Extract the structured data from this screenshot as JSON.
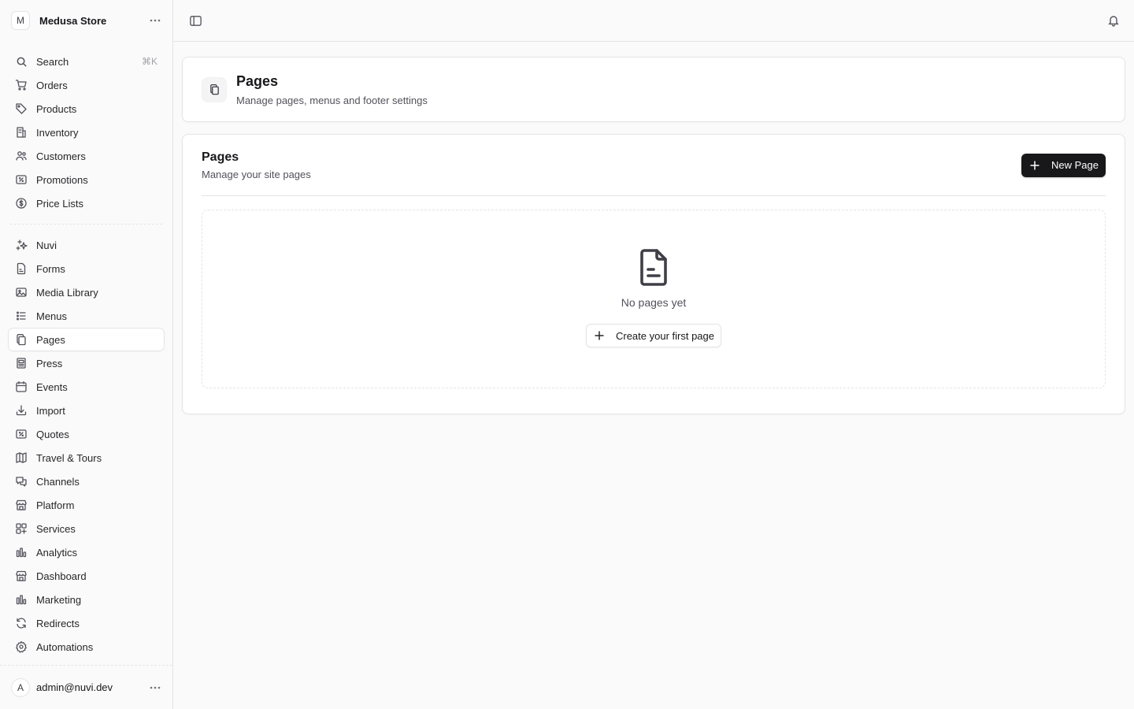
{
  "store": {
    "initial": "M",
    "name": "Medusa Store"
  },
  "search": {
    "label": "Search",
    "shortcut": "⌘K"
  },
  "nav_primary": [
    {
      "label": "Orders",
      "icon": "cart-icon"
    },
    {
      "label": "Products",
      "icon": "tag-icon"
    },
    {
      "label": "Inventory",
      "icon": "building-icon"
    },
    {
      "label": "Customers",
      "icon": "users-icon"
    },
    {
      "label": "Promotions",
      "icon": "receipt-percent-icon"
    },
    {
      "label": "Price Lists",
      "icon": "currency-dollar-icon"
    }
  ],
  "nav_extensions": [
    {
      "label": "Nuvi",
      "icon": "sparkles-icon"
    },
    {
      "label": "Forms",
      "icon": "document-text-icon"
    },
    {
      "label": "Media Library",
      "icon": "photo-icon"
    },
    {
      "label": "Menus",
      "icon": "list-bullet-icon"
    },
    {
      "label": "Pages",
      "icon": "documents-icon",
      "active": true
    },
    {
      "label": "Press",
      "icon": "newspaper-icon"
    },
    {
      "label": "Events",
      "icon": "calendar-icon"
    },
    {
      "label": "Import",
      "icon": "arrow-down-tray-icon"
    },
    {
      "label": "Quotes",
      "icon": "receipt-percent-icon"
    },
    {
      "label": "Travel & Tours",
      "icon": "map-icon"
    },
    {
      "label": "Channels",
      "icon": "chat-bubbles-icon"
    },
    {
      "label": "Platform",
      "icon": "building-storefront-icon"
    },
    {
      "label": "Services",
      "icon": "squares-plus-icon"
    },
    {
      "label": "Analytics",
      "icon": "bar-chart-icon"
    },
    {
      "label": "Dashboard",
      "icon": "building-storefront-icon"
    },
    {
      "label": "Marketing",
      "icon": "bar-chart-icon"
    },
    {
      "label": "Redirects",
      "icon": "arrow-path-icon"
    },
    {
      "label": "Automations",
      "icon": "cog-icon"
    }
  ],
  "user": {
    "initial": "A",
    "email": "admin@nuvi.dev"
  },
  "header": {
    "title": "Pages",
    "subtitle": "Manage pages, menus and footer settings"
  },
  "pages_section": {
    "title": "Pages",
    "subtitle": "Manage your site pages",
    "new_button": "New Page",
    "empty_text": "No pages yet",
    "create_button": "Create your first page"
  }
}
